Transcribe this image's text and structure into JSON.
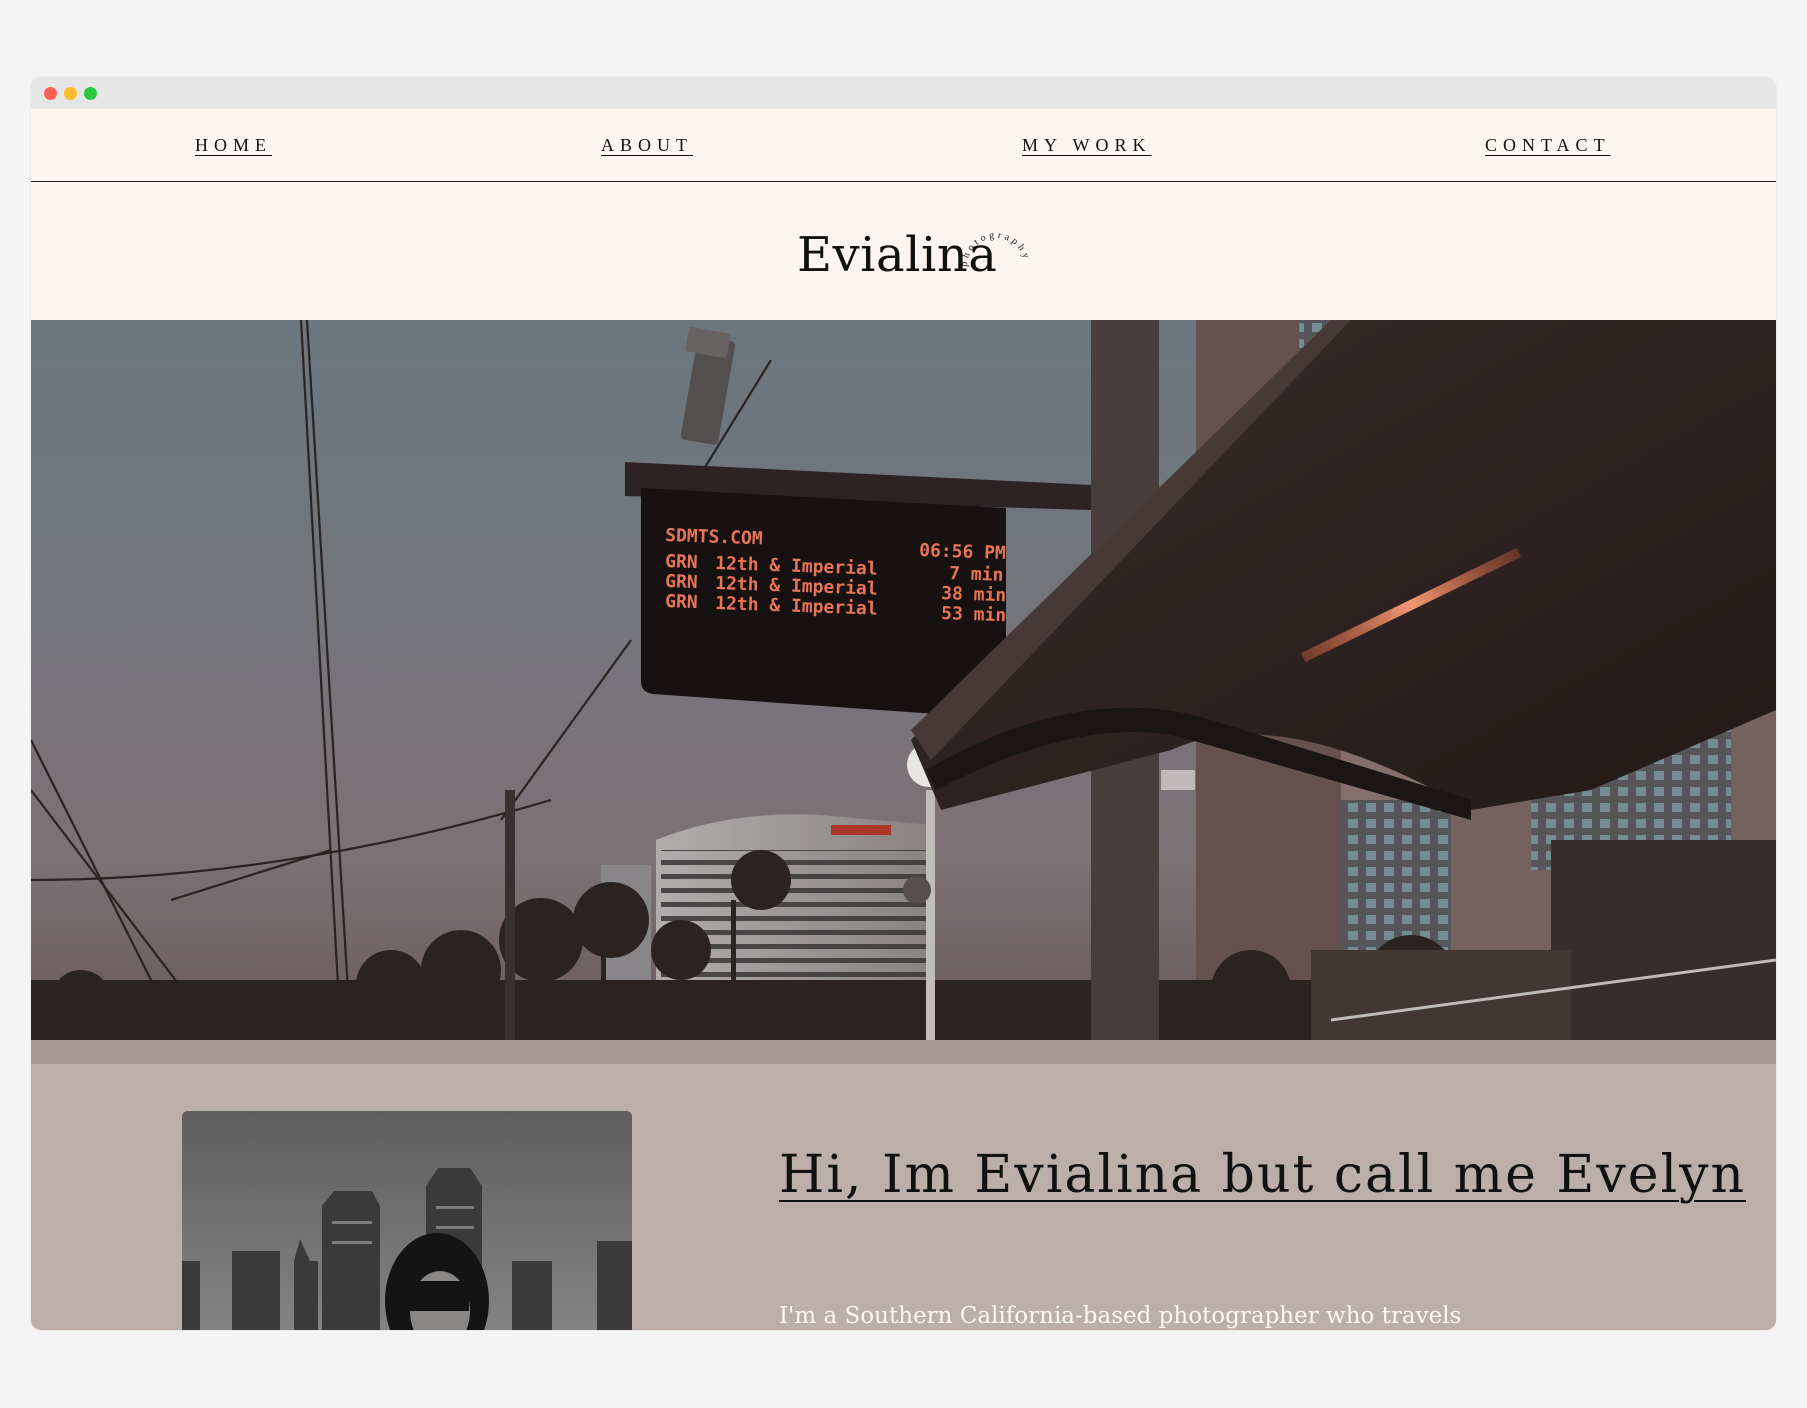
{
  "nav": {
    "items": [
      {
        "label": "HOME"
      },
      {
        "label": "ABOUT"
      },
      {
        "label": "MY WORK"
      },
      {
        "label": "CONTACT"
      }
    ]
  },
  "logo": {
    "name": "Evialina",
    "tagline": "photography"
  },
  "hero": {
    "sign": {
      "header": "SDMTS.COM",
      "time": "06:56 PM",
      "rows": [
        {
          "line": "GRN",
          "destination": "12th & Imperial",
          "eta": "7 min"
        },
        {
          "line": "GRN",
          "destination": "12th & Imperial",
          "eta": "38 min"
        },
        {
          "line": "GRN",
          "destination": "12th & Imperial",
          "eta": "53 min"
        }
      ]
    }
  },
  "about": {
    "title": "Hi, Im Evialina but call me Evelyn",
    "body": "I'm a Southern California-based photographer who travels"
  },
  "colors": {
    "page_bg": "#fcf5f1",
    "about_bg": "#bcaea9",
    "text": "#111111"
  }
}
